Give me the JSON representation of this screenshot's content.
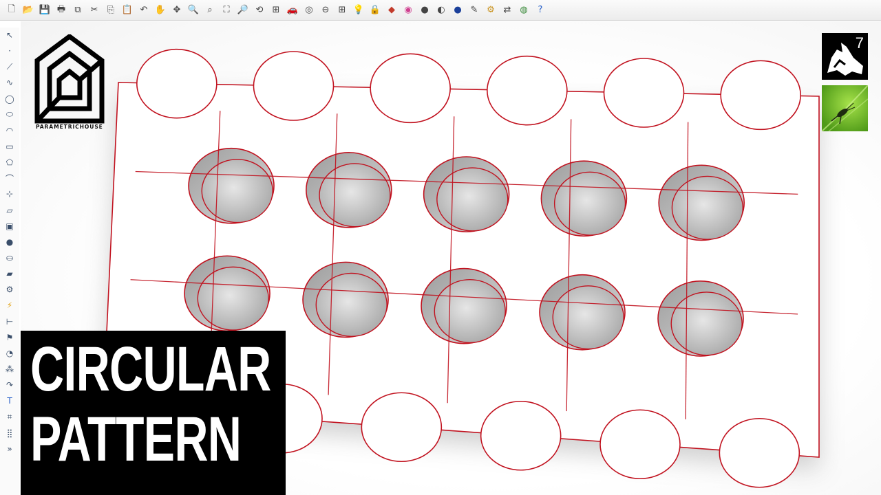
{
  "toolbar": {
    "icons": [
      "new-file",
      "open-folder",
      "save",
      "print",
      "copy-page",
      "cut",
      "copy",
      "paste",
      "undo",
      "pan",
      "move",
      "zoom",
      "zoom-window",
      "zoom-extents",
      "zoom-selected",
      "rotate-view",
      "four-viewports",
      "car",
      "camera-target",
      "named-views",
      "grid",
      "light-bulb",
      "lock",
      "layer-color",
      "color-wheel",
      "render-sphere",
      "shaded-sphere",
      "render-blue",
      "pen-tool",
      "gear-cluster",
      "grasshopper-arrows",
      "planet-globe",
      "help"
    ]
  },
  "sidebar": {
    "icons": [
      "select",
      "point",
      "polyline",
      "curve-interp",
      "circle",
      "ellipse",
      "arc",
      "rectangle",
      "polygon",
      "fillet",
      "transform-points",
      "surface",
      "box",
      "sphere-solid",
      "cylinder",
      "plane",
      "gear-edit",
      "lightning",
      "dimension",
      "flag-edit",
      "boolean",
      "points-on",
      "curve-hook",
      "text",
      "transform-grid",
      "array",
      "more"
    ]
  },
  "brand": {
    "name": "PARAMETRICHOUSE"
  },
  "title": {
    "line1": "CIRCULAR",
    "line2": "PATTERN"
  },
  "badges": {
    "rhino_version": "7"
  },
  "colors": {
    "edge": "#c1121f",
    "title_bg": "#000000",
    "title_fg": "#ffffff",
    "hole_shade": "#c4c4c4"
  }
}
